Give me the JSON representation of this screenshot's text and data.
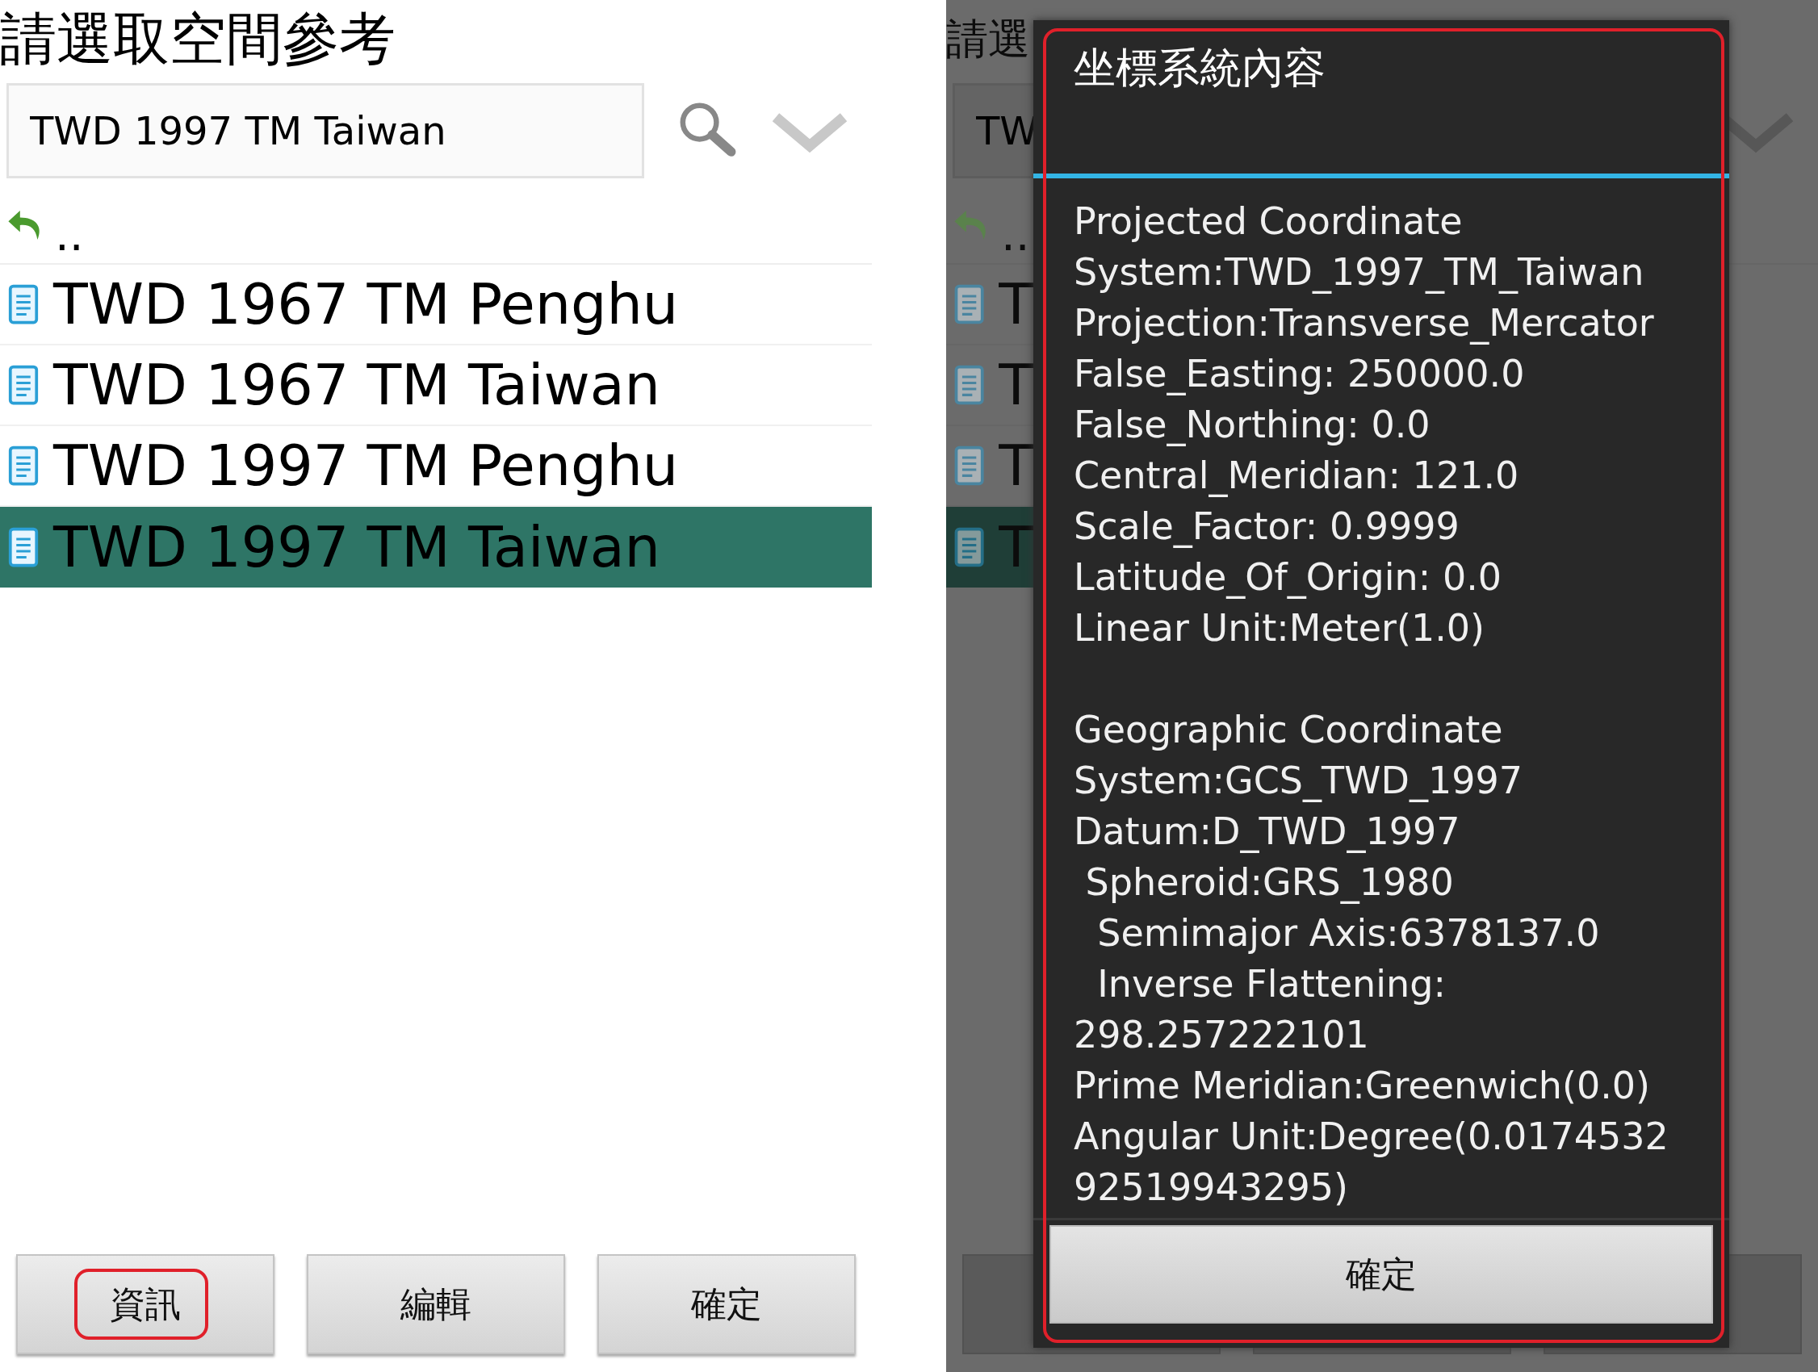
{
  "left_screen": {
    "title": "請選取空間參考",
    "search_field": {
      "value": "TWD 1997 TM Taiwan"
    },
    "parent_entry": "..",
    "items": [
      {
        "label": "TWD 1967 TM Penghu",
        "selected": false
      },
      {
        "label": "TWD 1967 TM Taiwan",
        "selected": false
      },
      {
        "label": "TWD 1997 TM Penghu",
        "selected": false
      },
      {
        "label": "TWD 1997 TM Taiwan",
        "selected": true
      }
    ],
    "buttons": [
      {
        "label": "資訊",
        "highlighted": true
      },
      {
        "label": "編輯",
        "highlighted": false
      },
      {
        "label": "確定",
        "highlighted": false
      }
    ]
  },
  "right_screen": {
    "title": "請選",
    "search_field": {
      "value": "TW"
    },
    "parent_entry": "..",
    "items": [
      {
        "label": "T",
        "selected": false
      },
      {
        "label": "T",
        "selected": false
      },
      {
        "label": "T",
        "selected": false
      },
      {
        "label": "T",
        "selected": true
      }
    ],
    "dialog": {
      "title": "坐標系統內容",
      "highlighted": true,
      "lines": [
        "Projected Coordinate",
        "System:TWD_1997_TM_Taiwan",
        "Projection:Transverse_Mercator",
        "False_Easting: 250000.0",
        "False_Northing: 0.0",
        "Central_Meridian: 121.0",
        "Scale_Factor: 0.9999",
        "Latitude_Of_Origin: 0.0",
        "Linear Unit:Meter(1.0)"
      ],
      "lines_2": [
        "Geographic Coordinate",
        "System:GCS_TWD_1997",
        "Datum:D_TWD_1997",
        " Spheroid:GRS_1980",
        "  Semimajor Axis:6378137.0",
        "  Inverse Flattening:",
        "298.257222101",
        "Prime Meridian:Greenwich(0.0)",
        "Angular Unit:Degree(0.0174532",
        "92519943295)"
      ],
      "button": "確定"
    }
  }
}
